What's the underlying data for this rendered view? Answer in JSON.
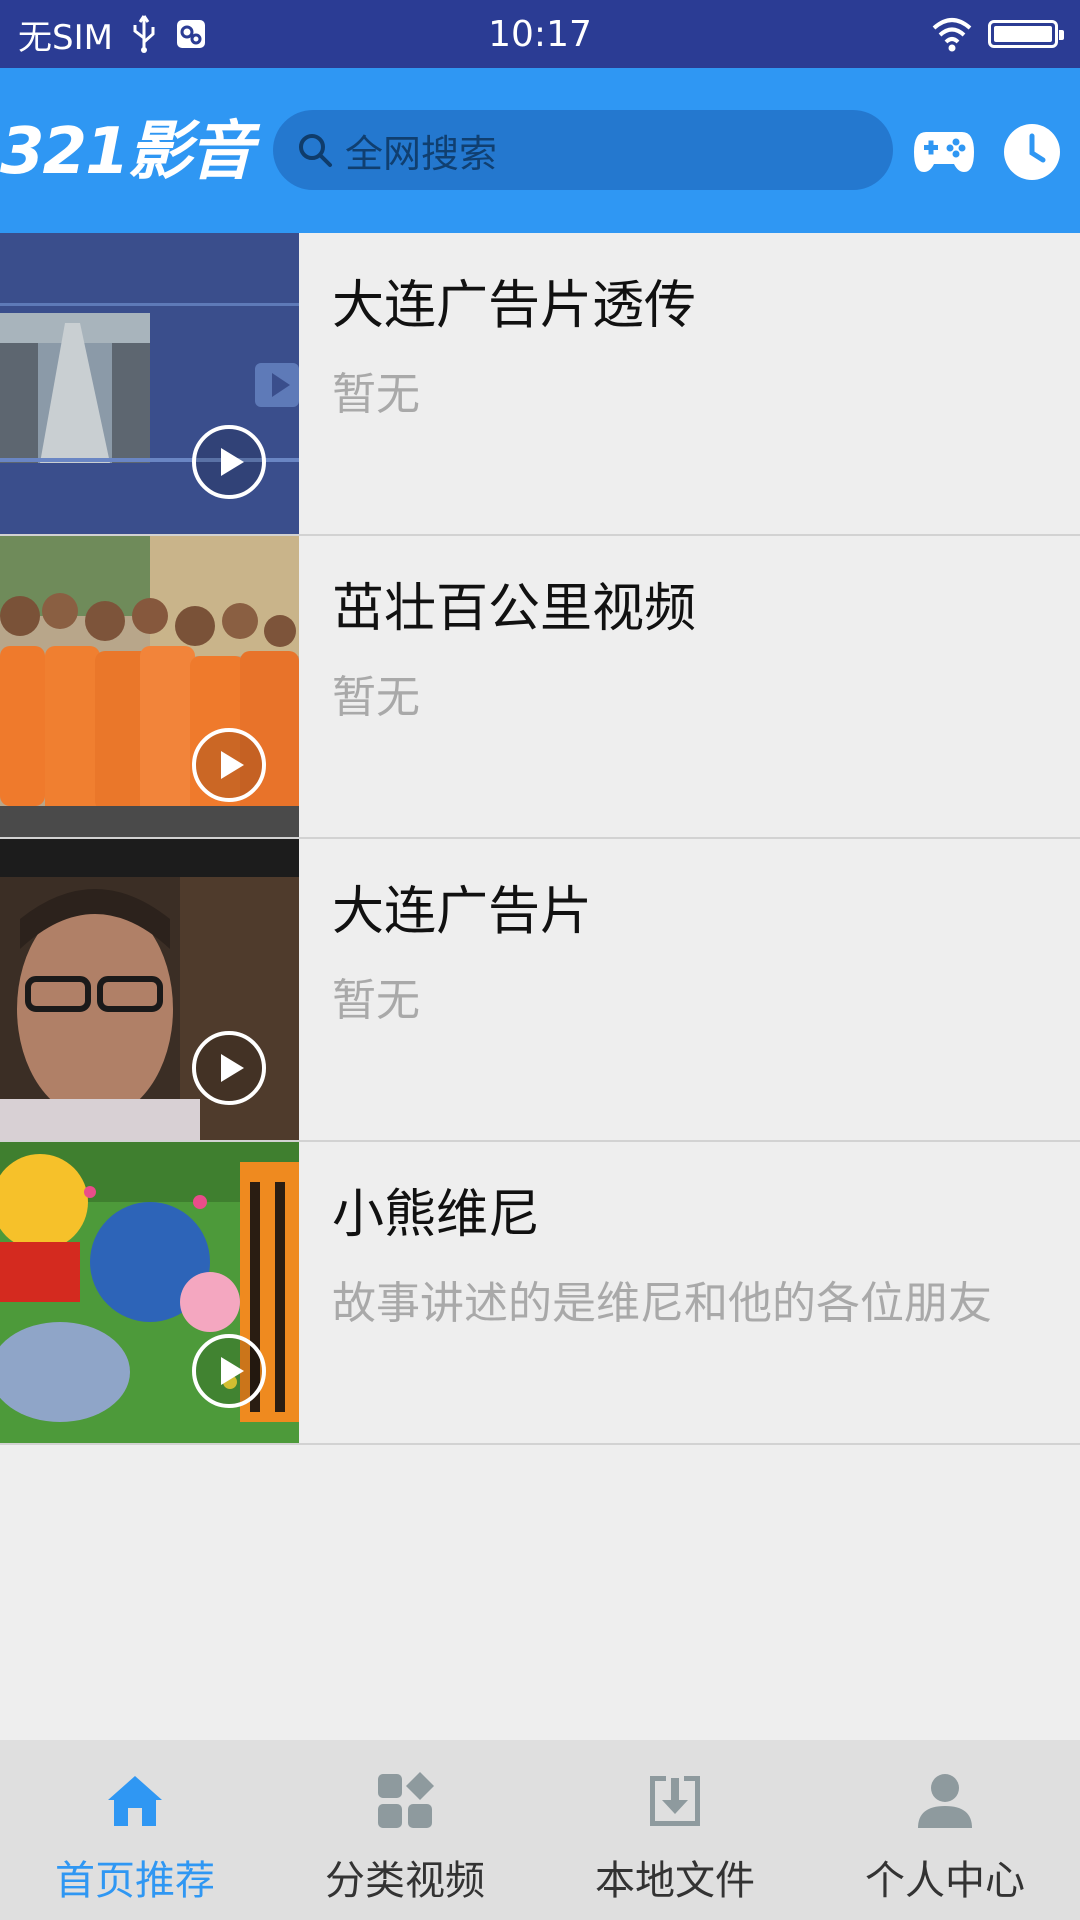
{
  "status_bar": {
    "carrier": "无SIM",
    "time": "10:17"
  },
  "header": {
    "logo": "321影音",
    "search_placeholder": "全网搜索",
    "game_icon": "gamepad-icon",
    "history_icon": "clock-icon"
  },
  "videos": [
    {
      "title": "大连广告片透传",
      "desc": "暂无"
    },
    {
      "title": "茁壮百公里视频",
      "desc": "暂无"
    },
    {
      "title": "大连广告片",
      "desc": "暂无"
    },
    {
      "title": "小熊维尼",
      "desc": "故事讲述的是维尼和他的各位朋友"
    }
  ],
  "bottom_nav": [
    {
      "label": "首页推荐",
      "icon": "home-icon",
      "active": true
    },
    {
      "label": "分类视频",
      "icon": "category-icon",
      "active": false
    },
    {
      "label": "本地文件",
      "icon": "download-icon",
      "active": false
    },
    {
      "label": "个人中心",
      "icon": "user-icon",
      "active": false
    }
  ],
  "colors": {
    "status_bar": "#2b3c94",
    "header": "#2f97f3",
    "search_box": "#2478cf",
    "active_tab": "#2f97f3",
    "background": "#eeeeee"
  }
}
